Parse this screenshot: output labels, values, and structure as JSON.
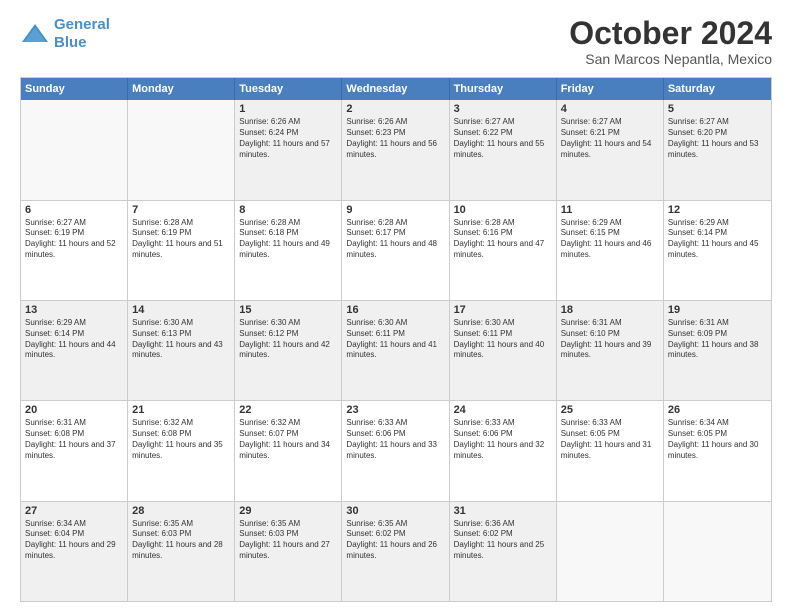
{
  "header": {
    "logo_line1": "General",
    "logo_line2": "Blue",
    "month": "October 2024",
    "location": "San Marcos Nepantla, Mexico"
  },
  "weekdays": [
    "Sunday",
    "Monday",
    "Tuesday",
    "Wednesday",
    "Thursday",
    "Friday",
    "Saturday"
  ],
  "rows": [
    [
      {
        "day": "",
        "text": "",
        "empty": true
      },
      {
        "day": "",
        "text": "",
        "empty": true
      },
      {
        "day": "1",
        "text": "Sunrise: 6:26 AM\nSunset: 6:24 PM\nDaylight: 11 hours and 57 minutes."
      },
      {
        "day": "2",
        "text": "Sunrise: 6:26 AM\nSunset: 6:23 PM\nDaylight: 11 hours and 56 minutes."
      },
      {
        "day": "3",
        "text": "Sunrise: 6:27 AM\nSunset: 6:22 PM\nDaylight: 11 hours and 55 minutes."
      },
      {
        "day": "4",
        "text": "Sunrise: 6:27 AM\nSunset: 6:21 PM\nDaylight: 11 hours and 54 minutes."
      },
      {
        "day": "5",
        "text": "Sunrise: 6:27 AM\nSunset: 6:20 PM\nDaylight: 11 hours and 53 minutes."
      }
    ],
    [
      {
        "day": "6",
        "text": "Sunrise: 6:27 AM\nSunset: 6:19 PM\nDaylight: 11 hours and 52 minutes."
      },
      {
        "day": "7",
        "text": "Sunrise: 6:28 AM\nSunset: 6:19 PM\nDaylight: 11 hours and 51 minutes."
      },
      {
        "day": "8",
        "text": "Sunrise: 6:28 AM\nSunset: 6:18 PM\nDaylight: 11 hours and 49 minutes."
      },
      {
        "day": "9",
        "text": "Sunrise: 6:28 AM\nSunset: 6:17 PM\nDaylight: 11 hours and 48 minutes."
      },
      {
        "day": "10",
        "text": "Sunrise: 6:28 AM\nSunset: 6:16 PM\nDaylight: 11 hours and 47 minutes."
      },
      {
        "day": "11",
        "text": "Sunrise: 6:29 AM\nSunset: 6:15 PM\nDaylight: 11 hours and 46 minutes."
      },
      {
        "day": "12",
        "text": "Sunrise: 6:29 AM\nSunset: 6:14 PM\nDaylight: 11 hours and 45 minutes."
      }
    ],
    [
      {
        "day": "13",
        "text": "Sunrise: 6:29 AM\nSunset: 6:14 PM\nDaylight: 11 hours and 44 minutes."
      },
      {
        "day": "14",
        "text": "Sunrise: 6:30 AM\nSunset: 6:13 PM\nDaylight: 11 hours and 43 minutes."
      },
      {
        "day": "15",
        "text": "Sunrise: 6:30 AM\nSunset: 6:12 PM\nDaylight: 11 hours and 42 minutes."
      },
      {
        "day": "16",
        "text": "Sunrise: 6:30 AM\nSunset: 6:11 PM\nDaylight: 11 hours and 41 minutes."
      },
      {
        "day": "17",
        "text": "Sunrise: 6:30 AM\nSunset: 6:11 PM\nDaylight: 11 hours and 40 minutes."
      },
      {
        "day": "18",
        "text": "Sunrise: 6:31 AM\nSunset: 6:10 PM\nDaylight: 11 hours and 39 minutes."
      },
      {
        "day": "19",
        "text": "Sunrise: 6:31 AM\nSunset: 6:09 PM\nDaylight: 11 hours and 38 minutes."
      }
    ],
    [
      {
        "day": "20",
        "text": "Sunrise: 6:31 AM\nSunset: 6:08 PM\nDaylight: 11 hours and 37 minutes."
      },
      {
        "day": "21",
        "text": "Sunrise: 6:32 AM\nSunset: 6:08 PM\nDaylight: 11 hours and 35 minutes."
      },
      {
        "day": "22",
        "text": "Sunrise: 6:32 AM\nSunset: 6:07 PM\nDaylight: 11 hours and 34 minutes."
      },
      {
        "day": "23",
        "text": "Sunrise: 6:33 AM\nSunset: 6:06 PM\nDaylight: 11 hours and 33 minutes."
      },
      {
        "day": "24",
        "text": "Sunrise: 6:33 AM\nSunset: 6:06 PM\nDaylight: 11 hours and 32 minutes."
      },
      {
        "day": "25",
        "text": "Sunrise: 6:33 AM\nSunset: 6:05 PM\nDaylight: 11 hours and 31 minutes."
      },
      {
        "day": "26",
        "text": "Sunrise: 6:34 AM\nSunset: 6:05 PM\nDaylight: 11 hours and 30 minutes."
      }
    ],
    [
      {
        "day": "27",
        "text": "Sunrise: 6:34 AM\nSunset: 6:04 PM\nDaylight: 11 hours and 29 minutes."
      },
      {
        "day": "28",
        "text": "Sunrise: 6:35 AM\nSunset: 6:03 PM\nDaylight: 11 hours and 28 minutes."
      },
      {
        "day": "29",
        "text": "Sunrise: 6:35 AM\nSunset: 6:03 PM\nDaylight: 11 hours and 27 minutes."
      },
      {
        "day": "30",
        "text": "Sunrise: 6:35 AM\nSunset: 6:02 PM\nDaylight: 11 hours and 26 minutes."
      },
      {
        "day": "31",
        "text": "Sunrise: 6:36 AM\nSunset: 6:02 PM\nDaylight: 11 hours and 25 minutes."
      },
      {
        "day": "",
        "text": "",
        "empty": true
      },
      {
        "day": "",
        "text": "",
        "empty": true
      }
    ]
  ]
}
